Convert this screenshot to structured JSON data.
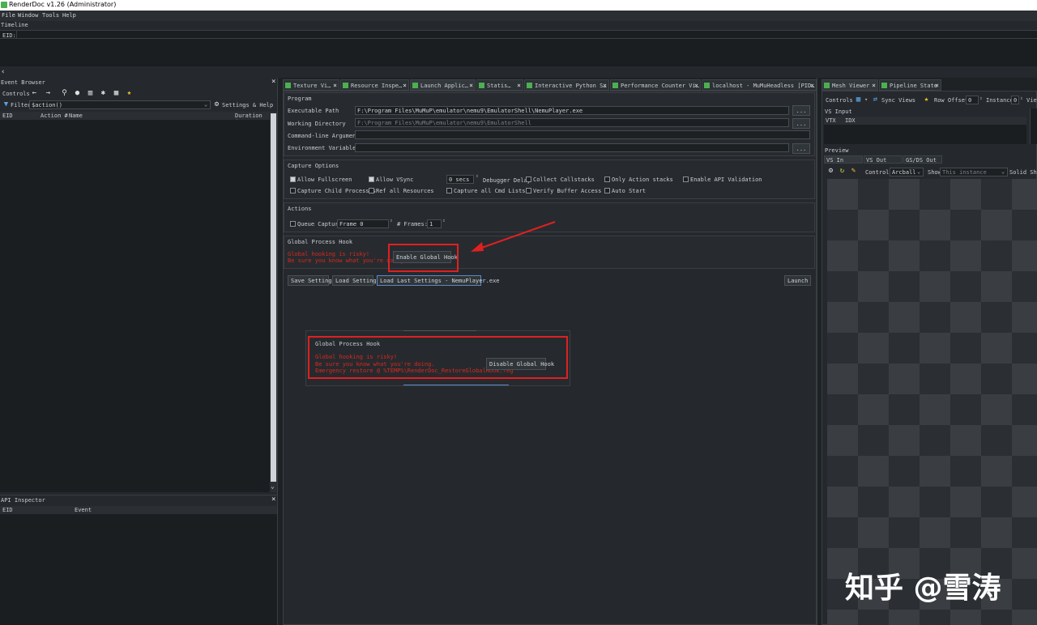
{
  "window": {
    "title": "RenderDoc v1.26 (Administrator)"
  },
  "menu": [
    "File",
    "Window",
    "Tools",
    "Help"
  ],
  "timeline": {
    "title": "Timeline",
    "eid_label": "EID:"
  },
  "event_browser": {
    "title": "Event Browser",
    "controls_label": "Controls",
    "filter_label": "Filter",
    "filter_value": "$action()",
    "settings_label": "Settings & Help",
    "columns": [
      "EID",
      "Action #",
      "Name",
      "Duration (µ"
    ]
  },
  "api_inspector": {
    "title": "API Inspector",
    "columns": [
      "EID",
      "Event"
    ]
  },
  "center_tabs": [
    "Texture Vi…",
    "Resource Inspe…",
    "Launch Applic…",
    "Statis…",
    "Interactive Python S…",
    "Performance Counter Vi…",
    "localhost - MuMuHeadless [PID…"
  ],
  "program": {
    "title": "Program",
    "exe_label": "Executable Path",
    "exe_value": "F:\\Program Files\\MuMuP\\emulator\\nemu9\\EmulatorShell\\NemuPlayer.exe",
    "wd_label": "Working Directory",
    "wd_value": "F:\\Program Files\\MuMuP\\emulator\\nemu9\\EmulatorShell",
    "args_label": "Command-line Arguments",
    "env_label": "Environment Variables",
    "browse": "..."
  },
  "capture_options": {
    "title": "Capture Options",
    "allow_fullscreen": "Allow Fullscreen",
    "allow_vsync": "Allow VSync",
    "delay_value": "0 secs",
    "debugger_delay": "Debugger Delay",
    "collect_callstacks": "Collect Callstacks",
    "only_action_stacks": "Only Action stacks",
    "enable_api_validation": "Enable API Validation",
    "capture_child": "Capture Child Processes",
    "ref_all": "Ref all Resources",
    "capture_all_cmd": "Capture all Cmd Lists",
    "verify_buffer": "Verify Buffer Access",
    "auto_start": "Auto Start"
  },
  "actions": {
    "title": "Actions",
    "queue_capture": "Queue Capture",
    "frame_value": "Frame 0",
    "frames_label": "# Frames:",
    "frames_value": "1"
  },
  "global_hook": {
    "title": "Global Process Hook",
    "warn1": "Global hooking is risky!",
    "warn2": "Be sure you know what you're doing.",
    "enable_button": "Enable Global Hook"
  },
  "bottom_buttons": {
    "save": "Save Settings",
    "load": "Load Settings",
    "load_last": "Load Last Settings - NemuPlayer.exe",
    "launch": "Launch"
  },
  "popup_hook": {
    "title": "Global Process Hook",
    "warn1": "Global hooking is risky!",
    "warn2": "Be sure you know what you're doing.",
    "warn3": "Emergency restore @ %TEMP%\\RenderDoc_RestoreGlobalHook.reg",
    "disable_button": "Disable Global Hook"
  },
  "right_tabs": [
    "Mesh Viewer",
    "Pipeline State"
  ],
  "mesh_viewer": {
    "controls_label": "Controls",
    "sync_views": "Sync Views",
    "row_offset_label": "Row Offset",
    "row_offset_value": "0",
    "instance_label": "Instance",
    "instance_value": "0",
    "view_label": "View",
    "vs_input": "VS Input",
    "vtx": "VTX",
    "idx": "IDX",
    "preview": "Preview",
    "preview_tabs": [
      "VS In",
      "VS Out",
      "GS/DS Out"
    ],
    "controls2": "Controls",
    "camera_value": "Arcball",
    "show_label": "Show",
    "show_value": "This instance",
    "solid_label": "Solid Shad"
  },
  "watermark": "知乎 @雪涛"
}
